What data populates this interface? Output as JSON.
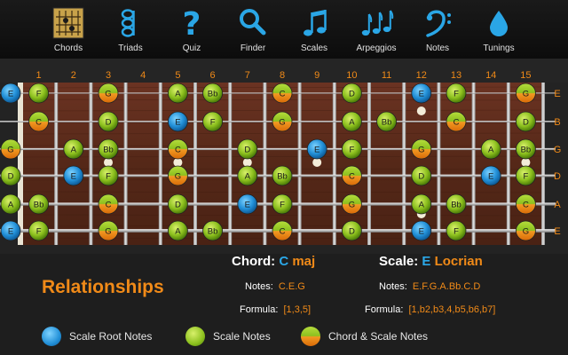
{
  "toolbar": [
    {
      "label": "Chords",
      "icon": "chord-grid-icon"
    },
    {
      "label": "Triads",
      "icon": "triad-notes-icon"
    },
    {
      "label": "Quiz",
      "icon": "question-mark-icon"
    },
    {
      "label": "Finder",
      "icon": "magnifier-icon"
    },
    {
      "label": "Scales",
      "icon": "music-notes-icon"
    },
    {
      "label": "Arpeggios",
      "icon": "triple-notes-icon"
    },
    {
      "label": "Notes",
      "icon": "bass-clef-icon"
    },
    {
      "label": "Tunings",
      "icon": "drop-icon"
    }
  ],
  "fret_numbers": [
    "1",
    "2",
    "3",
    "4",
    "5",
    "6",
    "7",
    "8",
    "9",
    "10",
    "11",
    "12",
    "13",
    "14",
    "15"
  ],
  "string_labels": [
    "E",
    "B",
    "G",
    "D",
    "A",
    "E"
  ],
  "open_notes": [
    {
      "note": "E",
      "type": "root"
    },
    {
      "note": "",
      "type": "none"
    },
    {
      "note": "G",
      "type": "chord"
    },
    {
      "note": "D",
      "type": "scale"
    },
    {
      "note": "A",
      "type": "scale"
    },
    {
      "note": "E",
      "type": "root"
    }
  ],
  "fretboard_notes": [
    [
      {
        "f": 1,
        "n": "F",
        "t": "scale"
      },
      {
        "f": 3,
        "n": "G",
        "t": "chord"
      },
      {
        "f": 5,
        "n": "A",
        "t": "scale"
      },
      {
        "f": 6,
        "n": "Bb",
        "t": "scale"
      },
      {
        "f": 8,
        "n": "C",
        "t": "chord"
      },
      {
        "f": 10,
        "n": "D",
        "t": "scale"
      },
      {
        "f": 12,
        "n": "E",
        "t": "root"
      },
      {
        "f": 13,
        "n": "F",
        "t": "scale"
      },
      {
        "f": 15,
        "n": "G",
        "t": "chord"
      }
    ],
    [
      {
        "f": 1,
        "n": "C",
        "t": "chord"
      },
      {
        "f": 3,
        "n": "D",
        "t": "scale"
      },
      {
        "f": 5,
        "n": "E",
        "t": "root"
      },
      {
        "f": 6,
        "n": "F",
        "t": "scale"
      },
      {
        "f": 8,
        "n": "G",
        "t": "chord"
      },
      {
        "f": 10,
        "n": "A",
        "t": "scale"
      },
      {
        "f": 11,
        "n": "Bb",
        "t": "scale"
      },
      {
        "f": 13,
        "n": "C",
        "t": "chord"
      },
      {
        "f": 15,
        "n": "D",
        "t": "scale"
      }
    ],
    [
      {
        "f": 2,
        "n": "A",
        "t": "scale"
      },
      {
        "f": 3,
        "n": "Bb",
        "t": "scale"
      },
      {
        "f": 5,
        "n": "C",
        "t": "chord"
      },
      {
        "f": 7,
        "n": "D",
        "t": "scale"
      },
      {
        "f": 9,
        "n": "E",
        "t": "root"
      },
      {
        "f": 10,
        "n": "F",
        "t": "scale"
      },
      {
        "f": 12,
        "n": "G",
        "t": "chord"
      },
      {
        "f": 14,
        "n": "A",
        "t": "scale"
      },
      {
        "f": 15,
        "n": "Bb",
        "t": "scale"
      }
    ],
    [
      {
        "f": 2,
        "n": "E",
        "t": "root"
      },
      {
        "f": 3,
        "n": "F",
        "t": "scale"
      },
      {
        "f": 5,
        "n": "G",
        "t": "chord"
      },
      {
        "f": 7,
        "n": "A",
        "t": "scale"
      },
      {
        "f": 8,
        "n": "Bb",
        "t": "scale"
      },
      {
        "f": 10,
        "n": "C",
        "t": "chord"
      },
      {
        "f": 12,
        "n": "D",
        "t": "scale"
      },
      {
        "f": 14,
        "n": "E",
        "t": "root"
      },
      {
        "f": 15,
        "n": "F",
        "t": "scale"
      }
    ],
    [
      {
        "f": 1,
        "n": "Bb",
        "t": "scale"
      },
      {
        "f": 3,
        "n": "C",
        "t": "chord"
      },
      {
        "f": 5,
        "n": "D",
        "t": "scale"
      },
      {
        "f": 7,
        "n": "E",
        "t": "root"
      },
      {
        "f": 8,
        "n": "F",
        "t": "scale"
      },
      {
        "f": 10,
        "n": "G",
        "t": "chord"
      },
      {
        "f": 12,
        "n": "A",
        "t": "scale"
      },
      {
        "f": 13,
        "n": "Bb",
        "t": "scale"
      },
      {
        "f": 15,
        "n": "C",
        "t": "chord"
      }
    ],
    [
      {
        "f": 1,
        "n": "F",
        "t": "scale"
      },
      {
        "f": 3,
        "n": "G",
        "t": "chord"
      },
      {
        "f": 5,
        "n": "A",
        "t": "scale"
      },
      {
        "f": 6,
        "n": "Bb",
        "t": "scale"
      },
      {
        "f": 8,
        "n": "C",
        "t": "chord"
      },
      {
        "f": 10,
        "n": "D",
        "t": "scale"
      },
      {
        "f": 12,
        "n": "E",
        "t": "root"
      },
      {
        "f": 13,
        "n": "F",
        "t": "scale"
      },
      {
        "f": 15,
        "n": "G",
        "t": "chord"
      }
    ]
  ],
  "inlay_frets": [
    3,
    5,
    7,
    9,
    12,
    15
  ],
  "relationships_title": "Relationships",
  "chord": {
    "heading": "Chord:",
    "root": "C",
    "quality": "maj",
    "notes_label": "Notes:",
    "notes": "C.E.G",
    "formula_label": "Formula:",
    "formula": "[1,3,5]"
  },
  "scale": {
    "heading": "Scale:",
    "root": "E",
    "name": "Locrian",
    "notes_label": "Notes:",
    "notes": "E.F.G.A.Bb.C.D",
    "formula_label": "Formula:",
    "formula": "[1,b2,b3,4,b5,b6,b7]"
  },
  "legend": [
    {
      "label": "Scale Root Notes",
      "type": "root"
    },
    {
      "label": "Scale Notes",
      "type": "scale"
    },
    {
      "label": "Chord & Scale Notes",
      "type": "chord"
    }
  ],
  "colors": {
    "accent_orange": "#f08a18",
    "root_blue": "#2aa6e6",
    "scale_green": "#8cc01e",
    "chord_orange": "#f08a18",
    "wood": "#5a2a1c"
  }
}
